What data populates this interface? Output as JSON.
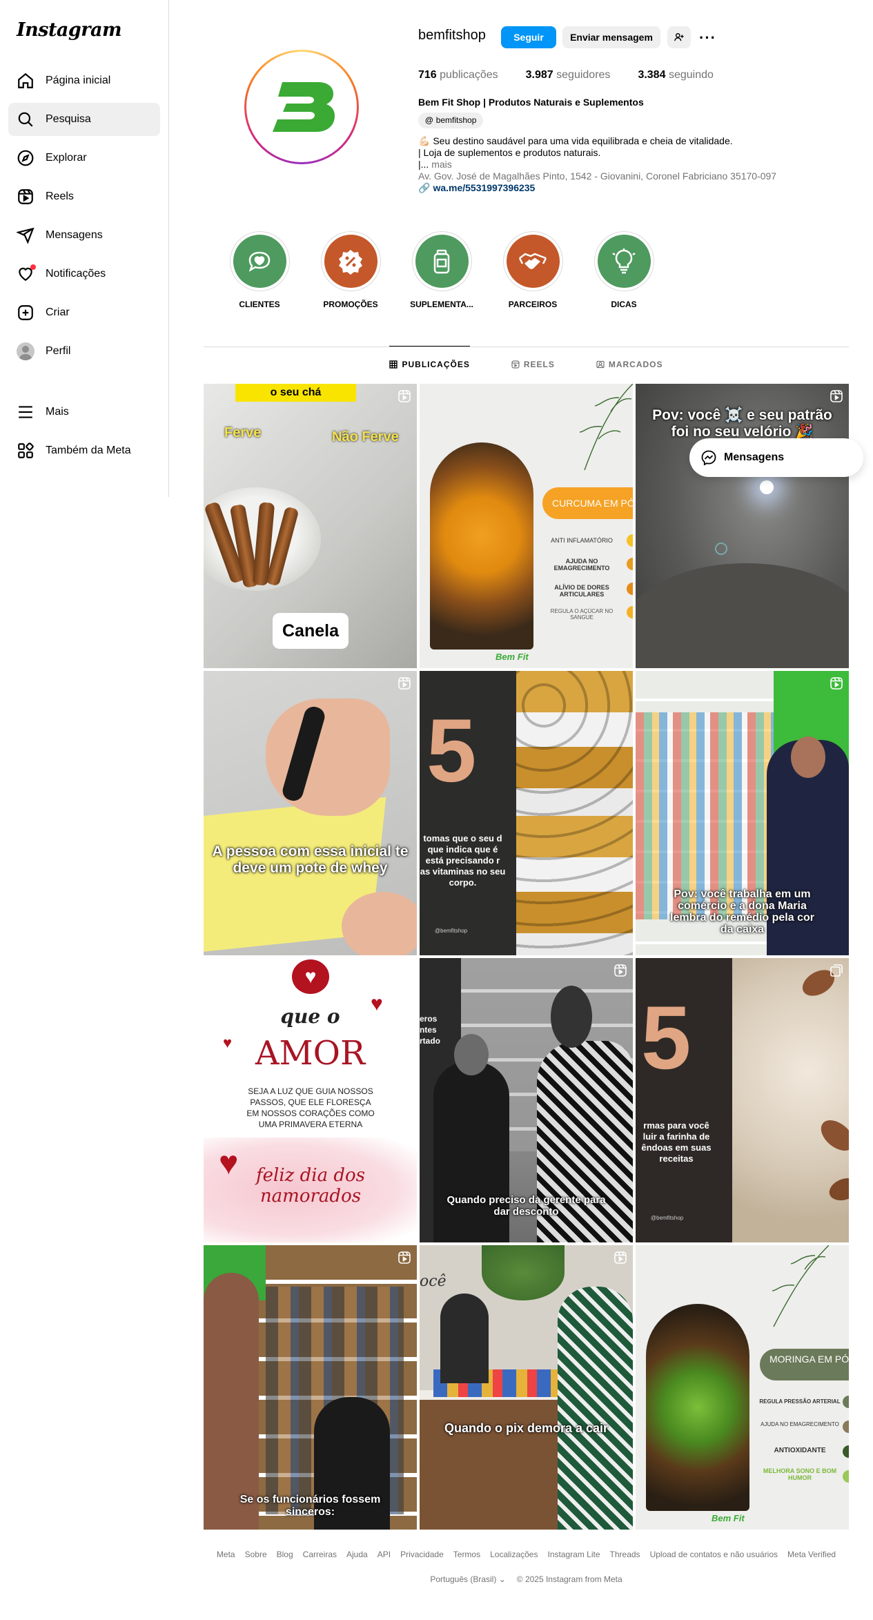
{
  "sidebar": {
    "logo": "Instagram",
    "items": [
      {
        "label": "Página inicial",
        "icon": "home-icon"
      },
      {
        "label": "Pesquisa",
        "icon": "search-icon"
      },
      {
        "label": "Explorar",
        "icon": "compass-icon"
      },
      {
        "label": "Reels",
        "icon": "reels-icon"
      },
      {
        "label": "Mensagens",
        "icon": "send-icon"
      },
      {
        "label": "Notificações",
        "icon": "heart-icon"
      },
      {
        "label": "Criar",
        "icon": "plus-square-icon"
      },
      {
        "label": "Perfil",
        "icon": "avatar"
      }
    ],
    "more": "Mais",
    "meta": "Também da Meta"
  },
  "profile": {
    "username": "bemfitshop",
    "follow_label": "Seguir",
    "message_label": "Enviar mensagem",
    "stats": {
      "posts_count": "716",
      "posts_label": "publicações",
      "followers_count": "3.987",
      "followers_label": "seguidores",
      "following_count": "3.384",
      "following_label": "seguindo"
    },
    "full_name": "Bem Fit Shop | Produtos Naturais e Suplementos",
    "threads_handle": "bemfitshop",
    "bio_line1": "💪🏻 Seu destino saudável para uma vida equilibrada e cheia de vitalidade.",
    "bio_line2": "| Loja de suplementos e produtos naturais.",
    "bio_line3": "|...",
    "bio_more": "mais",
    "address": "Av. Gov. José de Magalhães Pinto, 1542 - Giovanini, Coronel Fabriciano 35170-097",
    "link": "wa.me/5531997396235",
    "brand_color": "#3aaa35"
  },
  "highlights": [
    {
      "label": "CLIENTES",
      "color": "#4e9a5f",
      "icon": "chat-heart-icon"
    },
    {
      "label": "PROMOÇÕES",
      "color": "#c4582a",
      "icon": "discount-badge-icon"
    },
    {
      "label": "SUPLEMENTA...",
      "color": "#4e9a5f",
      "icon": "supplement-jar-icon"
    },
    {
      "label": "PARCEIROS",
      "color": "#c4582a",
      "icon": "handshake-icon"
    },
    {
      "label": "DICAS",
      "color": "#4e9a5f",
      "icon": "lightbulb-icon"
    }
  ],
  "tabs": {
    "posts": "PUBLICAÇÕES",
    "reels": "REELS",
    "tagged": "MARCADOS"
  },
  "posts": {
    "p1": {
      "top": "o seu chá",
      "left": "Ferve",
      "right": "Não Ferve",
      "bottom": "Canela"
    },
    "p2": {
      "title": "CURCUMA EM PÓ",
      "b1": "ANTI INFLAMATÓRIO",
      "b2": "AJUDA NO EMAGRECIMENTO",
      "b3": "ALÍVIO DE DORES ARTICULARES",
      "b4": "REGULA O AÇÚCAR NO SANGUE",
      "brand": "Bem Fit"
    },
    "p3": {
      "caption": "Pov: você ☠️ e seu patrão foi no seu velório 🎉"
    },
    "p4": {
      "caption": "A pessoa com essa inicial te deve um pote de whey"
    },
    "p5": {
      "number": "5",
      "caption": "tomas que o seu d que indica que é está precisando r as vitaminas no seu corpo.",
      "handle": "@bemfitshop"
    },
    "p6": {
      "caption": "Pov: você trabalha em um comércio e a dona Maria lembra do remédio pela cor da caixa"
    },
    "p7": {
      "l1": "que o",
      "l2": "AMOR",
      "l3": "SEJA A LUZ QUE GUIA NOSSOS PASSOS, QUE ELE FLORESÇA EM NOSSOS CORAÇÕES COMO UMA PRIMAVERA ETERNA",
      "l4": "feliz dia dos namorados"
    },
    "p8": {
      "caption": "Quando preciso da gerente para dar desconto",
      "sign": "eros ntes rtado"
    },
    "p9": {
      "number": "5",
      "caption": "rmas para você luir a farinha de êndoas em suas receitas",
      "handle": "@bemfitshop"
    },
    "p10": {
      "caption": "Se os funcionários fossem sinceros:"
    },
    "p11": {
      "caption": "Quando o pix demora a cair",
      "wall": "ocê"
    },
    "p12": {
      "title": "MORINGA EM PÓ",
      "b1": "REGULA PRESSÃO ARTERIAL",
      "b2": "AJUDA NO EMAGRECIMENTO",
      "b3": "ANTIOXIDANTE",
      "b4": "MELHORA SONO E BOM HUMOR",
      "brand": "Bem Fit"
    }
  },
  "floating_messages": "Mensagens",
  "footer": {
    "links": [
      "Meta",
      "Sobre",
      "Blog",
      "Carreiras",
      "Ajuda",
      "API",
      "Privacidade",
      "Termos",
      "Localizações",
      "Instagram Lite",
      "Threads",
      "Upload de contatos e não usuários",
      "Meta Verified"
    ],
    "language": "Português (Brasil)",
    "copyright": "© 2025 Instagram from Meta"
  }
}
